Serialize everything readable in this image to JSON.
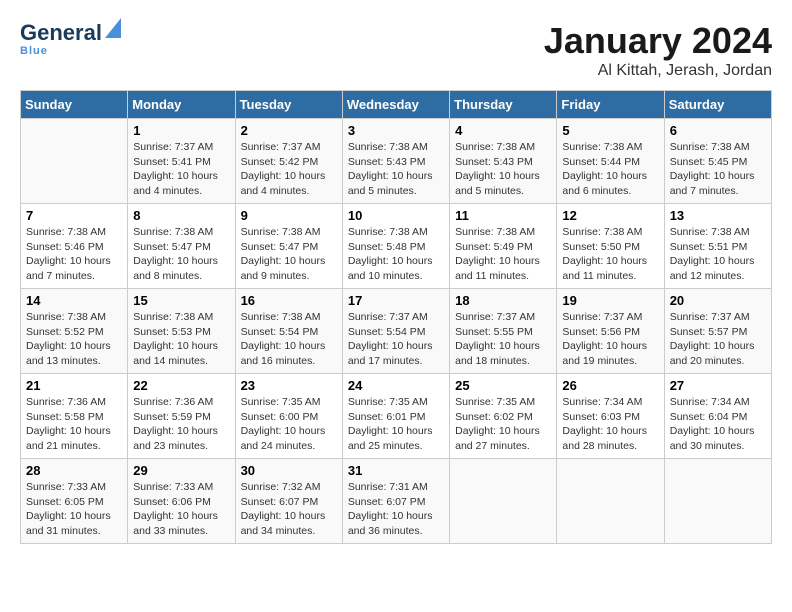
{
  "header": {
    "logo_general": "General",
    "logo_blue": "Blue",
    "month_year": "January 2024",
    "location": "Al Kittah, Jerash, Jordan"
  },
  "calendar": {
    "days_of_week": [
      "Sunday",
      "Monday",
      "Tuesday",
      "Wednesday",
      "Thursday",
      "Friday",
      "Saturday"
    ],
    "weeks": [
      [
        {
          "day": "",
          "info": ""
        },
        {
          "day": "1",
          "info": "Sunrise: 7:37 AM\nSunset: 5:41 PM\nDaylight: 10 hours\nand 4 minutes."
        },
        {
          "day": "2",
          "info": "Sunrise: 7:37 AM\nSunset: 5:42 PM\nDaylight: 10 hours\nand 4 minutes."
        },
        {
          "day": "3",
          "info": "Sunrise: 7:38 AM\nSunset: 5:43 PM\nDaylight: 10 hours\nand 5 minutes."
        },
        {
          "day": "4",
          "info": "Sunrise: 7:38 AM\nSunset: 5:43 PM\nDaylight: 10 hours\nand 5 minutes."
        },
        {
          "day": "5",
          "info": "Sunrise: 7:38 AM\nSunset: 5:44 PM\nDaylight: 10 hours\nand 6 minutes."
        },
        {
          "day": "6",
          "info": "Sunrise: 7:38 AM\nSunset: 5:45 PM\nDaylight: 10 hours\nand 7 minutes."
        }
      ],
      [
        {
          "day": "7",
          "info": "Sunrise: 7:38 AM\nSunset: 5:46 PM\nDaylight: 10 hours\nand 7 minutes."
        },
        {
          "day": "8",
          "info": "Sunrise: 7:38 AM\nSunset: 5:47 PM\nDaylight: 10 hours\nand 8 minutes."
        },
        {
          "day": "9",
          "info": "Sunrise: 7:38 AM\nSunset: 5:47 PM\nDaylight: 10 hours\nand 9 minutes."
        },
        {
          "day": "10",
          "info": "Sunrise: 7:38 AM\nSunset: 5:48 PM\nDaylight: 10 hours\nand 10 minutes."
        },
        {
          "day": "11",
          "info": "Sunrise: 7:38 AM\nSunset: 5:49 PM\nDaylight: 10 hours\nand 11 minutes."
        },
        {
          "day": "12",
          "info": "Sunrise: 7:38 AM\nSunset: 5:50 PM\nDaylight: 10 hours\nand 11 minutes."
        },
        {
          "day": "13",
          "info": "Sunrise: 7:38 AM\nSunset: 5:51 PM\nDaylight: 10 hours\nand 12 minutes."
        }
      ],
      [
        {
          "day": "14",
          "info": "Sunrise: 7:38 AM\nSunset: 5:52 PM\nDaylight: 10 hours\nand 13 minutes."
        },
        {
          "day": "15",
          "info": "Sunrise: 7:38 AM\nSunset: 5:53 PM\nDaylight: 10 hours\nand 14 minutes."
        },
        {
          "day": "16",
          "info": "Sunrise: 7:38 AM\nSunset: 5:54 PM\nDaylight: 10 hours\nand 16 minutes."
        },
        {
          "day": "17",
          "info": "Sunrise: 7:37 AM\nSunset: 5:54 PM\nDaylight: 10 hours\nand 17 minutes."
        },
        {
          "day": "18",
          "info": "Sunrise: 7:37 AM\nSunset: 5:55 PM\nDaylight: 10 hours\nand 18 minutes."
        },
        {
          "day": "19",
          "info": "Sunrise: 7:37 AM\nSunset: 5:56 PM\nDaylight: 10 hours\nand 19 minutes."
        },
        {
          "day": "20",
          "info": "Sunrise: 7:37 AM\nSunset: 5:57 PM\nDaylight: 10 hours\nand 20 minutes."
        }
      ],
      [
        {
          "day": "21",
          "info": "Sunrise: 7:36 AM\nSunset: 5:58 PM\nDaylight: 10 hours\nand 21 minutes."
        },
        {
          "day": "22",
          "info": "Sunrise: 7:36 AM\nSunset: 5:59 PM\nDaylight: 10 hours\nand 23 minutes."
        },
        {
          "day": "23",
          "info": "Sunrise: 7:35 AM\nSunset: 6:00 PM\nDaylight: 10 hours\nand 24 minutes."
        },
        {
          "day": "24",
          "info": "Sunrise: 7:35 AM\nSunset: 6:01 PM\nDaylight: 10 hours\nand 25 minutes."
        },
        {
          "day": "25",
          "info": "Sunrise: 7:35 AM\nSunset: 6:02 PM\nDaylight: 10 hours\nand 27 minutes."
        },
        {
          "day": "26",
          "info": "Sunrise: 7:34 AM\nSunset: 6:03 PM\nDaylight: 10 hours\nand 28 minutes."
        },
        {
          "day": "27",
          "info": "Sunrise: 7:34 AM\nSunset: 6:04 PM\nDaylight: 10 hours\nand 30 minutes."
        }
      ],
      [
        {
          "day": "28",
          "info": "Sunrise: 7:33 AM\nSunset: 6:05 PM\nDaylight: 10 hours\nand 31 minutes."
        },
        {
          "day": "29",
          "info": "Sunrise: 7:33 AM\nSunset: 6:06 PM\nDaylight: 10 hours\nand 33 minutes."
        },
        {
          "day": "30",
          "info": "Sunrise: 7:32 AM\nSunset: 6:07 PM\nDaylight: 10 hours\nand 34 minutes."
        },
        {
          "day": "31",
          "info": "Sunrise: 7:31 AM\nSunset: 6:07 PM\nDaylight: 10 hours\nand 36 minutes."
        },
        {
          "day": "",
          "info": ""
        },
        {
          "day": "",
          "info": ""
        },
        {
          "day": "",
          "info": ""
        }
      ]
    ]
  }
}
